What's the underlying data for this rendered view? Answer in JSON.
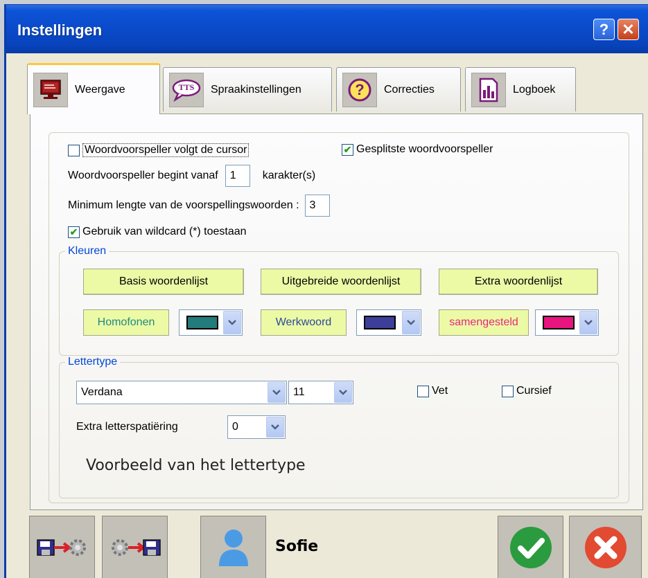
{
  "window": {
    "title": "Instellingen",
    "help_label": "?",
    "close_label": "✕"
  },
  "tabs": [
    {
      "label": "Weergave",
      "icon": "monitor-icon",
      "active": true
    },
    {
      "label": "Spraakinstellingen",
      "icon": "tts-icon",
      "icon_text": "TTS"
    },
    {
      "label": "Correcties",
      "icon": "help-circle-icon",
      "icon_text": "?"
    },
    {
      "label": "Logboek",
      "icon": "bar-chart-icon"
    }
  ],
  "predictor": {
    "follow_cursor_label": "Woordvoorspeller volgt de cursor",
    "follow_cursor_checked": false,
    "split_label": "Gesplitste woordvoorspeller",
    "split_checked": true,
    "start_from_label": "Woordvoorspeller begint vanaf",
    "start_from_value": "1",
    "start_from_unit": "karakter(s)",
    "min_length_label": "Minimum lengte van de voorspellingswoorden :",
    "min_length_value": "3",
    "wildcard_label": "Gebruik van wildcard (*) toestaan",
    "wildcard_checked": true
  },
  "colors_group": {
    "legend": "Kleuren",
    "buttons": [
      "Basis woordenlijst",
      "Uitgebreide woordenlijst",
      "Extra woordenlijst"
    ],
    "items": [
      {
        "label": "Homofonen",
        "text_color": "#1f8a7d",
        "swatch": "#237b7b"
      },
      {
        "label": "Werkwoord",
        "text_color": "#2a4a9a",
        "swatch": "#3d3d9a"
      },
      {
        "label": "samengesteld",
        "text_color": "#e8277f",
        "swatch": "#e8147f"
      }
    ]
  },
  "font_group": {
    "legend": "Lettertype",
    "font_name": "Verdana",
    "font_size": "11",
    "bold_label": "Vet",
    "bold_checked": false,
    "italic_label": "Cursief",
    "italic_checked": false,
    "spacing_label": "Extra letterspatiëring",
    "spacing_value": "0",
    "preview_text": "Voorbeeld van het lettertype"
  },
  "footer": {
    "user_name": "Sofie",
    "colors": {
      "ok": "#2a9b3e",
      "cancel": "#e24a32"
    }
  }
}
